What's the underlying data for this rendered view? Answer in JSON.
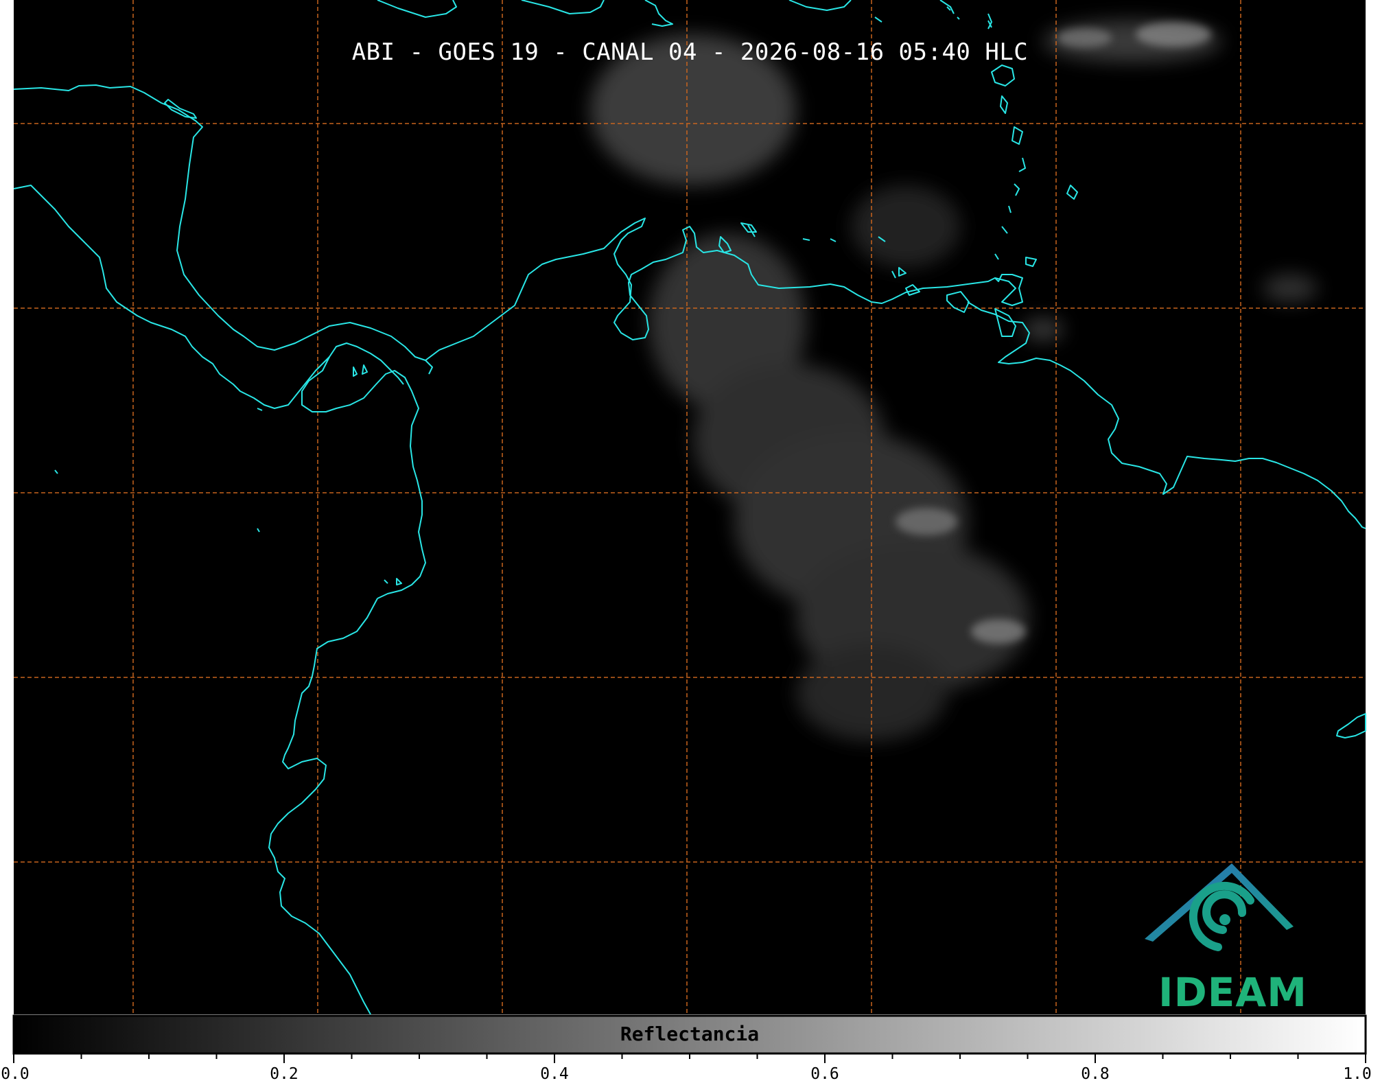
{
  "title": "ABI - GOES 19 - CANAL 04 - 2026-08-16 05:40 HLC",
  "colorbar": {
    "label": "Reflectancia",
    "range": [
      0.0,
      1.0
    ],
    "ticks": [
      "0.0",
      "0.2",
      "0.4",
      "0.6",
      "0.8",
      "1.0"
    ],
    "minor_step": 0.05,
    "colormap": [
      "#000000",
      "#ffffff"
    ]
  },
  "logo": {
    "text": "IDEAM",
    "colors": {
      "roof": "#2a6fb8",
      "swirl": "#1aa08a",
      "text": "#1fb37a"
    }
  },
  "map": {
    "background": "#000000",
    "coastline_color": "#29e6e6",
    "gridline_color": "#c8641e",
    "gridline_style": "dashed",
    "cloud_color": "#9a9a9a"
  }
}
